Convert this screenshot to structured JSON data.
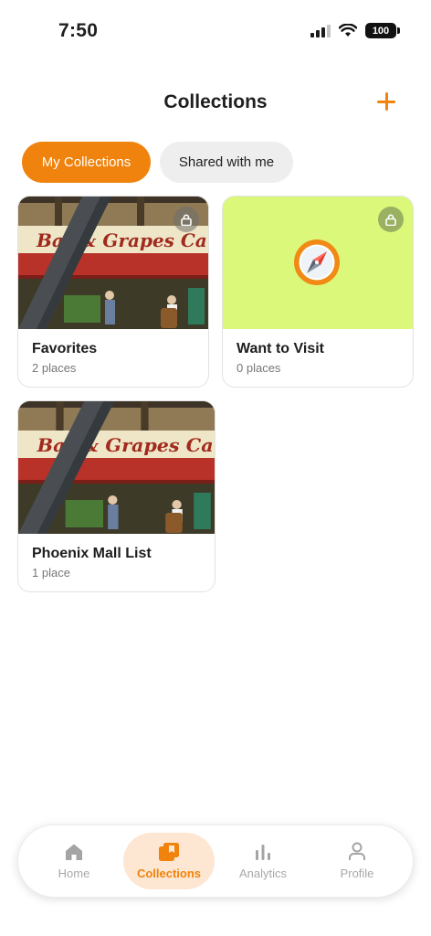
{
  "status_bar": {
    "time": "7:50",
    "battery": "100"
  },
  "header": {
    "title": "Collections"
  },
  "tabs": [
    {
      "label": "My Collections",
      "active": true
    },
    {
      "label": "Shared with me",
      "active": false
    }
  ],
  "photo_sign_text": "Bar & Grapes Ca",
  "collections": [
    {
      "name": "Favorites",
      "count": "2 places",
      "image": "restaurant-photo",
      "private": true
    },
    {
      "name": "Want to Visit",
      "count": "0 places",
      "image": "compass-placeholder",
      "private": true
    },
    {
      "name": "Phoenix Mall List",
      "count": "1 place",
      "image": "restaurant-photo",
      "private": false
    }
  ],
  "bottom_nav": [
    {
      "label": "Home",
      "icon": "home-icon",
      "active": false
    },
    {
      "label": "Collections",
      "icon": "collections-icon",
      "active": true
    },
    {
      "label": "Analytics",
      "icon": "analytics-icon",
      "active": false
    },
    {
      "label": "Profile",
      "icon": "profile-icon",
      "active": false
    }
  ],
  "colors": {
    "accent": "#f0830d",
    "placeholder_bg": "#dbf87a",
    "inactive_tab_bg": "#eeeeee"
  }
}
